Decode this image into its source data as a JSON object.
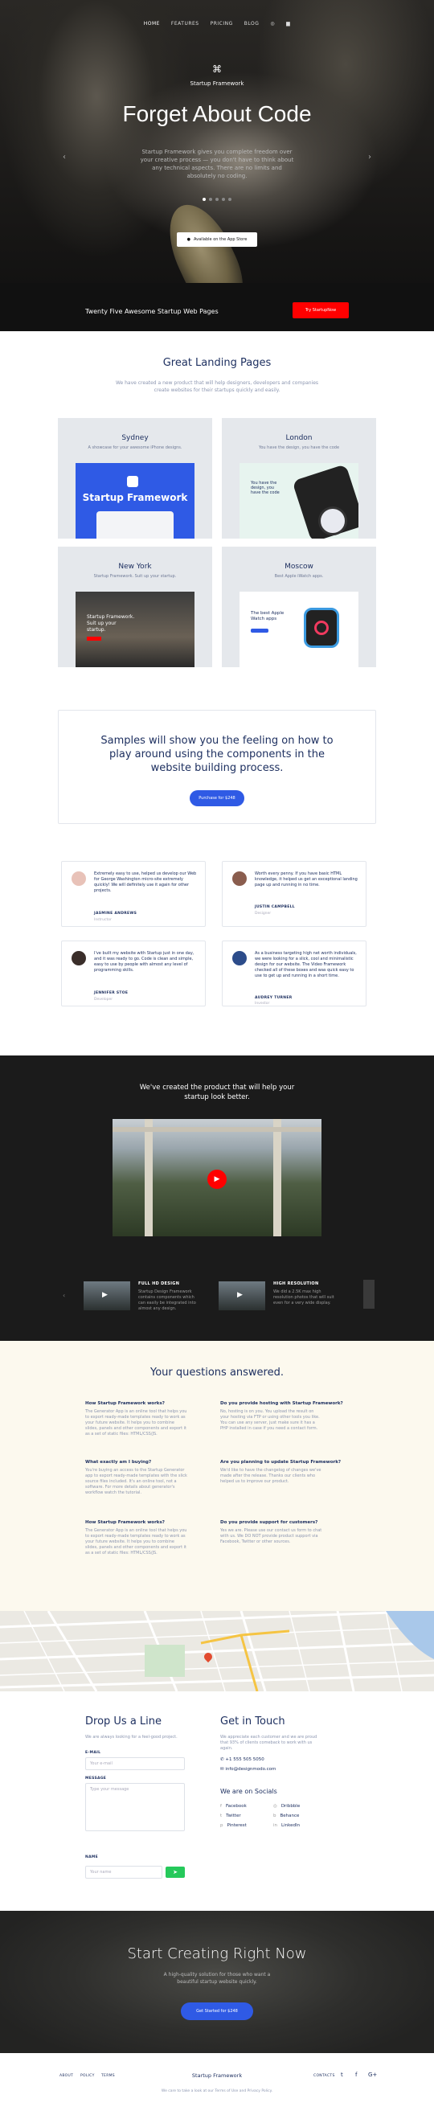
{
  "nav": {
    "items": [
      "HOME",
      "FEATURES",
      "PRICING",
      "BLOG"
    ]
  },
  "hero": {
    "brand": "Startup Framework",
    "title": "Forget About Code",
    "text": "Startup Framework gives you complete freedom over your creative process — you don't have to think about any technical aspects. There are no limits and absolutely no coding.",
    "appstore": "Available on the App Store",
    "bar_text": "Twenty Five Awesome Startup Web Pages",
    "bar_button": "Try StartupNow"
  },
  "landing": {
    "title": "Great Landing Pages",
    "subtitle": "We have created a new product that will help designers, developers and companies create websites for their startups quickly and easily.",
    "cards": [
      {
        "title": "Sydney",
        "desc": "A showcase for your awesome iPhone designs."
      },
      {
        "title": "London",
        "desc": "You have the design, you have the code"
      },
      {
        "title": "New York",
        "desc": "Startup Framework. Suit up your startup."
      },
      {
        "title": "Moscow",
        "desc": "Best Apple iWatch apps."
      }
    ],
    "shots": {
      "sydney_brand": "Startup Framework",
      "london_head": "You have the design, you have the code",
      "newyork_head": "Startup Framework. Suit up your startup.",
      "moscow_head": "The best Apple Watch apps"
    }
  },
  "samples": {
    "title": "Samples will show you the feeling on how to play around using the components in the website building process.",
    "button": "Purchase for $248"
  },
  "testimonials": [
    {
      "quote": "Extremely easy to use, helped us develop our Web for George Washington micro-site extremely quickly! We will definitely use it again for other projects.",
      "name": "JASMINE ANDREWS",
      "role": "Instructor"
    },
    {
      "quote": "Worth every penny. If you have basic HTML knowledge, it helped us get an exceptional landing page up and running in no time.",
      "name": "JUSTIN CAMPBELL",
      "role": "Designer"
    },
    {
      "quote": "I've built my website with Startup just in one day, and it was ready to go. Code is clean and simple, easy to use by people with almost any level of programming skills.",
      "name": "JENNIFER STOE",
      "role": "Developer"
    },
    {
      "quote": "As a business targeting high net worth individuals, we were looking for a slick, cool and minimalistic design for our website. The Video Framework checked all of these boxes and was quick easy to use to get up and running in a short time.",
      "name": "AUDREY TURNER",
      "role": "Investor"
    }
  ],
  "video": {
    "title": "We've created the product that will help your startup look better.",
    "items": [
      {
        "title": "FULL HD DESIGN",
        "desc": "Startup Design Framework contains components which can easily be integrated into almost any design."
      },
      {
        "title": "HIGH RESOLUTION",
        "desc": "We did a 2.5K max high resolution photos that will suit even for a very wide display."
      }
    ]
  },
  "faq": {
    "title": "Your questions answered.",
    "items": [
      {
        "q": "How Startup Framework works?",
        "a": "The Generator App is an online tool that helps you to export ready-made templates ready to work as your future website. It helps you to combine slides, panels and other components and export it as a set of static files: HTML/CSS/JS."
      },
      {
        "q": "Do you provide hosting with Startup Framework?",
        "a": "No, hosting is on you. You upload the result on your hosting via FTP or using other tools you like. You can use any server, just make sure it has a PHP installed in case if you need a contact form."
      },
      {
        "q": "What exactly am I buying?",
        "a": "You're buying an access to the Startup Generator app to export ready-made templates with the slick source files included. It's an online tool, not a software. For more details about generator's workflow watch the tutorial."
      },
      {
        "q": "Are you planning to update Startup Framework?",
        "a": "We'd like to have the changelog of changes we've made after the release. Thanks our clients who helped us to improve our product."
      },
      {
        "q": "How Startup Framework works?",
        "a": "The Generator App is an online tool that helps you to export ready-made templates ready to work as your future website. It helps you to combine slides, panels and other components and export it as a set of static files: HTML/CSS/JS."
      },
      {
        "q": "Do you provide support for customers?",
        "a": "Yes we are. Please use our contact us form to chat with us. We DO NOT provide product support via Facebook, Twitter or other sources."
      }
    ]
  },
  "contact": {
    "left_title": "Drop Us a Line",
    "left_text": "We are always looking for a feel-good project.",
    "email_label": "E-MAIL",
    "email_placeholder": "Your e-mail",
    "message_label": "MESSAGE",
    "message_placeholder": "Type your message",
    "name_label": "NAME",
    "name_placeholder": "Your name",
    "right_title": "Get in Touch",
    "right_text": "We appreciate each customer and we are proud that 93% of clients comeback to work with us again.",
    "phone": "+1 555 505 5050",
    "email": "info@designmodo.com",
    "socials_title": "We are on Socials",
    "socials": [
      "Facebook",
      "Dribbble",
      "Twitter",
      "Behance",
      "Pinterest",
      "LinkedIn"
    ]
  },
  "cta": {
    "title": "Start Creating Right Now",
    "text": "A high-quality solution for those who want a beautiful startup website quickly.",
    "button": "Get Started for $248"
  },
  "footer": {
    "links": [
      "ABOUT",
      "POLICY",
      "TERMS"
    ],
    "brand": "Startup Framework",
    "copy": "We care to take a look at our Terms of Use and Privacy Policy.",
    "contacts": "CONTACTS"
  }
}
